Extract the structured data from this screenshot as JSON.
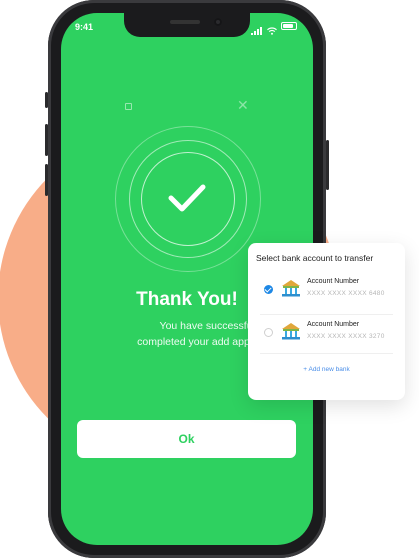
{
  "status_bar": {
    "time": "9:41"
  },
  "success": {
    "title": "Thank You!",
    "message_line1": "You have successfully",
    "message_line2": "completed your add approval pr",
    "ok_label": "Ok"
  },
  "bank_card": {
    "title": "Select bank account to transfer",
    "accounts": [
      {
        "label": "Account Number",
        "number": "XXXX XXXX XXXX 6480",
        "selected": true
      },
      {
        "label": "Account Number",
        "number": "XXXX XXXX XXXX 3270",
        "selected": false
      }
    ],
    "add_label": "+ Add new bank"
  },
  "colors": {
    "screen_green": "#2ed160",
    "blob_peach": "#f8ad88",
    "accent_blue": "#1e88e5"
  }
}
